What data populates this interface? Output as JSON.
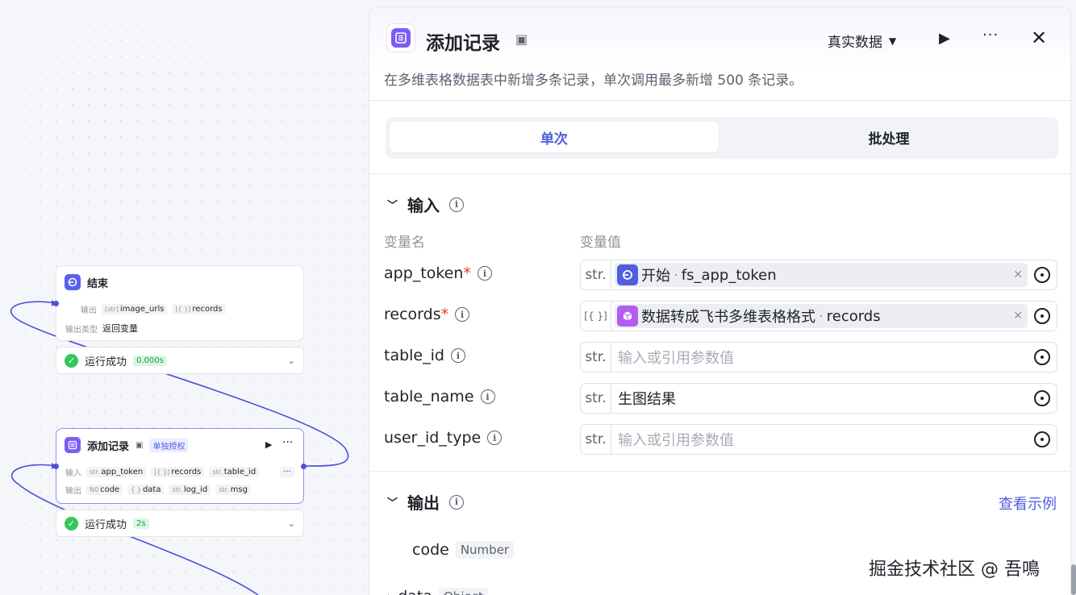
{
  "canvas": {
    "end_node": {
      "title": "结束",
      "output_label": "输出",
      "outputs": [
        {
          "type": "[str]",
          "name": "image_urls"
        },
        {
          "type": "[{ }]",
          "name": "records"
        }
      ],
      "output_type_label": "输出类型",
      "output_type_value": "返回变量",
      "run_status": "运行成功",
      "run_time": "0.000s"
    },
    "add_node": {
      "title": "添加记录",
      "auth_badge": "单独授权",
      "input_label": "输入",
      "inputs": [
        {
          "type": "str.",
          "name": "app_token"
        },
        {
          "type": "[{ }]",
          "name": "records"
        },
        {
          "type": "str.",
          "name": "table_id"
        }
      ],
      "output_label": "输出",
      "outputs": [
        {
          "type": "N0",
          "name": "code"
        },
        {
          "type": "{ }",
          "name": "data"
        },
        {
          "type": "str.",
          "name": "log_id"
        },
        {
          "type": "str.",
          "name": "msg"
        }
      ],
      "run_status": "运行成功",
      "run_time": "2s"
    }
  },
  "panel": {
    "title": "添加记录",
    "data_mode": "真实数据",
    "description": "在多维表格数据表中新增多条记录，单次调用最多新增 500 条记录。",
    "tabs": [
      {
        "label": "单次",
        "active": true
      },
      {
        "label": "批处理",
        "active": false
      }
    ],
    "input_section": {
      "title": "输入",
      "col_name": "变量名",
      "col_value": "变量值",
      "params": [
        {
          "name": "app_token",
          "required": true,
          "type": "str.",
          "kind": "ref",
          "source": "开始",
          "var": "fs_app_token",
          "icon": "start-icon",
          "icon_color": "#4e5fe0"
        },
        {
          "name": "records",
          "required": true,
          "type": "[{ }]",
          "kind": "ref",
          "source": "数据转成飞书多维表格格式",
          "var": "records",
          "icon": "cube-icon",
          "icon_color": "#b45cf0"
        },
        {
          "name": "table_id",
          "required": false,
          "type": "str.",
          "kind": "empty",
          "placeholder": "输入或引用参数值"
        },
        {
          "name": "table_name",
          "required": false,
          "type": "str.",
          "kind": "value",
          "value": "生图结果"
        },
        {
          "name": "user_id_type",
          "required": false,
          "type": "str.",
          "kind": "empty",
          "placeholder": "输入或引用参数值"
        }
      ]
    },
    "output_section": {
      "title": "输出",
      "view_example": "查看示例",
      "outputs": [
        {
          "name": "code",
          "type": "Number"
        },
        {
          "name": "data",
          "type": "Object"
        }
      ]
    }
  },
  "watermark": "掘金技术社区 @ 吾鳴",
  "colors": {
    "accent": "#4e5fe0",
    "node_purple": "#7c5cf5",
    "success": "#34c759",
    "wire": "#4e4fd6"
  }
}
